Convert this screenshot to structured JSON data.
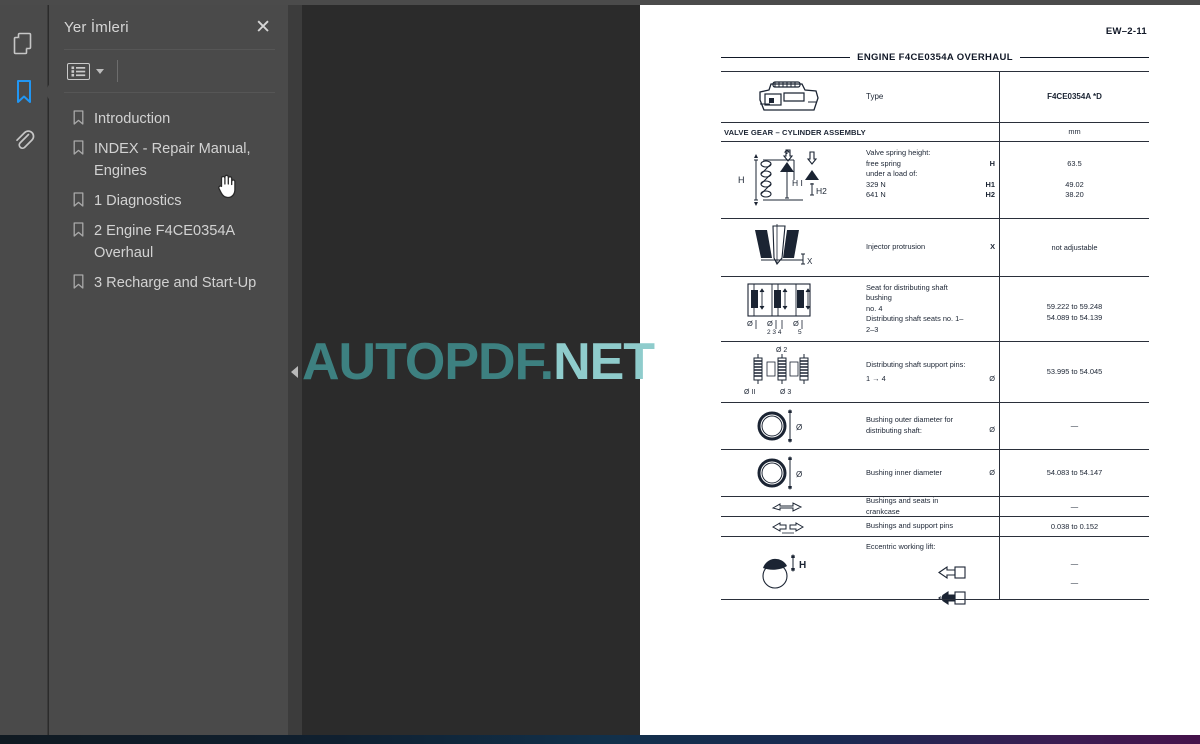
{
  "app": {
    "rail_icons": [
      {
        "name": "pages-thumbnails-icon",
        "label": "Sayfa Küçük Resimleri",
        "active": false
      },
      {
        "name": "bookmark-icon",
        "label": "Yer İmleri",
        "active": true
      },
      {
        "name": "attachment-icon",
        "label": "Ekler",
        "active": false
      }
    ]
  },
  "sidebar": {
    "title": "Yer İmleri",
    "close_label": "✕",
    "toolbar": {
      "list_options_label": "Seçenekler",
      "caret_label": "▾"
    },
    "items": [
      {
        "label": "Introduction"
      },
      {
        "label": "INDEX - Repair Manual, Engines"
      },
      {
        "label": "1 Diagnostics"
      },
      {
        "label": "2 Engine F4CE0354A Overhaul"
      },
      {
        "label": "3 Recharge and Start-Up"
      }
    ]
  },
  "viewer": {
    "collapse_label": "◀",
    "watermark": {
      "text_dark": "AUTOPDF.",
      "text_light": "NET",
      "full": "AUTOPDF.NET",
      "color": "#3d8080",
      "color_light": "#8fcccc"
    }
  },
  "page": {
    "page_number": "EW–2-11",
    "doc_title": "ENGINE F4CE0354A OVERHAUL",
    "header": {
      "figure_icon": "engine-block-icon",
      "desc": "Type",
      "symbol": "",
      "value": "F4CE0354A *D"
    },
    "section_bar": {
      "label": "VALVE GEAR – CYLINDER ASSEMBLY",
      "unit": "mm"
    },
    "rows": [
      {
        "figure_icon": "valve-spring-icon",
        "desc_lines": [
          "Valve spring height:",
          "free spring",
          "under a load of:",
          "329 N",
          "641 N"
        ],
        "symbols": [
          "",
          "H",
          "",
          "H1",
          "H2"
        ],
        "values": [
          "",
          "63.5",
          "",
          "49.02",
          "38.20"
        ]
      },
      {
        "figure_icon": "injector-protrusion-icon",
        "desc_lines": [
          "Injector protrusion"
        ],
        "symbols": [
          "X"
        ],
        "values": [
          "not adjustable"
        ]
      },
      {
        "figure_icon": "shaft-bushing-seats-icon",
        "desc_lines": [
          "Seat for distributing shaft bushing",
          "no. 4",
          "Distributing shaft seats no. 1–2–3"
        ],
        "symbols": [],
        "values": [
          "59.222 to 59.248",
          "54.089 to 54.139"
        ]
      },
      {
        "figure_icon": "support-pins-icon",
        "desc_lines": [
          "Distributing shaft support pins:",
          "1 → 4"
        ],
        "symbols": [
          "",
          "Ø"
        ],
        "values": [
          "53.995 to 54.045"
        ]
      },
      {
        "figure_icon": "bushing-outer-diameter-icon",
        "desc_lines": [
          "Bushing outer diameter for",
          "distributing shaft:"
        ],
        "symbols": [
          "",
          "Ø"
        ],
        "values": [
          "—"
        ]
      },
      {
        "figure_icon": "bushing-inner-diameter-icon",
        "desc_lines": [
          "Bushing inner diameter"
        ],
        "symbols": [
          "Ø"
        ],
        "values": [
          "54.083 to 54.147"
        ]
      },
      {
        "figure_icon": "interference-fit-icon",
        "desc_lines": [
          "Bushings and seats in crankcase"
        ],
        "symbols": [],
        "values": [
          "—"
        ]
      },
      {
        "figure_icon": "clearance-fit-icon",
        "desc_lines": [
          "Bushings and support pins"
        ],
        "symbols": [],
        "values": [
          "0.038 to 0.152"
        ]
      },
      {
        "figure_icon": "eccentric-lift-icon",
        "desc_lines": [
          "Eccentric working lift:"
        ],
        "symbols": [
          "intake-tool-icon",
          "exhaust-tool-icon"
        ],
        "values": [
          "—",
          "—"
        ]
      }
    ]
  }
}
